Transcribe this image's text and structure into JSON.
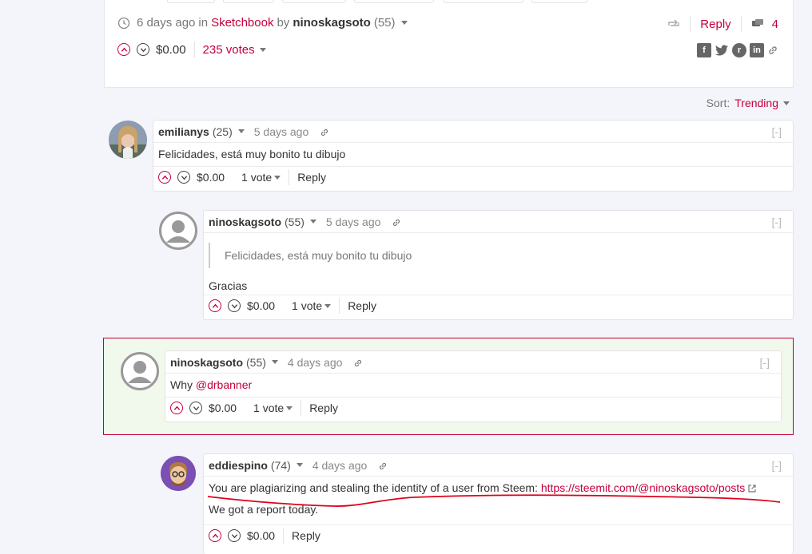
{
  "post": {
    "time": "6 days ago",
    "in_label": "in",
    "community": "Sketchbook",
    "by_label": "by",
    "author": "ninoskagsoto",
    "author_rep": "(55)",
    "payout": "$0.00",
    "votes": "235 votes",
    "reply_label": "Reply",
    "comment_count": "4",
    "share_icons": [
      "facebook-icon",
      "twitter-icon",
      "reddit-icon",
      "linkedin-icon",
      "link-icon"
    ]
  },
  "sort": {
    "label": "Sort:",
    "value": "Trending"
  },
  "comments": [
    {
      "author": "emilianys",
      "rep": "(25)",
      "time": "5 days ago",
      "collapse": "[-]",
      "body": "Felicidades, está muy bonito tu dibujo",
      "payout": "$0.00",
      "votes": "1 vote",
      "reply": "Reply"
    },
    {
      "author": "ninoskagsoto",
      "rep": "(55)",
      "time": "5 days ago",
      "collapse": "[-]",
      "quote": "Felicidades, está muy bonito tu dibujo",
      "body": "Gracias",
      "payout": "$0.00",
      "votes": "1 vote",
      "reply": "Reply"
    },
    {
      "author": "ninoskagsoto",
      "rep": "(55)",
      "time": "4 days ago",
      "collapse": "[-]",
      "body_prefix": "Why",
      "mention": "@drbanner",
      "payout": "$0.00",
      "votes": "1 vote",
      "reply": "Reply"
    },
    {
      "author": "eddiespino",
      "rep": "(74)",
      "time": "4 days ago",
      "collapse": "[-]",
      "body_prefix": "You are plagiarizing and stealing the identity of a user from Steem:",
      "link": "https://steemit.com/@ninoskagsoto/posts",
      "body2": "We got a report today.",
      "payout": "$0.00",
      "reply": "Reply"
    }
  ],
  "colors": {
    "accent": "#c4003b",
    "highlight_bg": "#f1f8ec",
    "page_bg": "#f4f4fb"
  }
}
